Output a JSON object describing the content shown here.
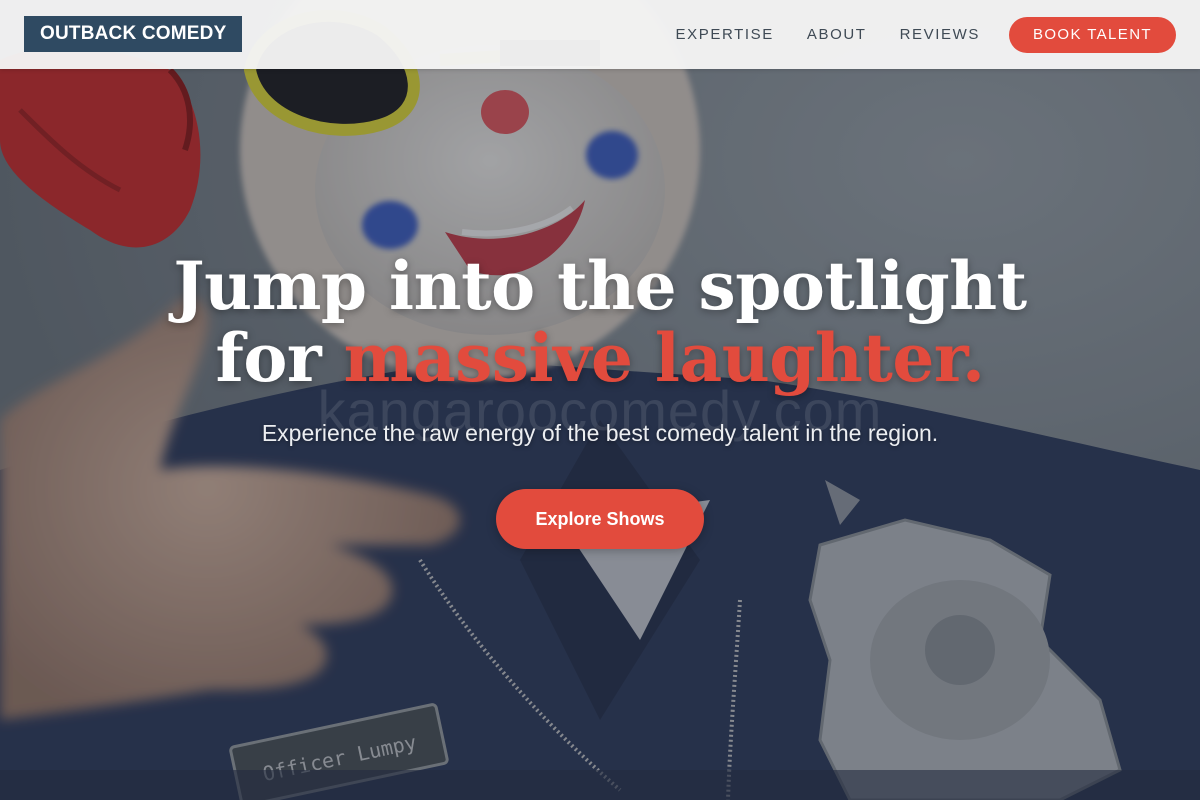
{
  "header": {
    "logo": "OUTBACK COMEDY",
    "nav": [
      {
        "label": "EXPERTISE"
      },
      {
        "label": "ABOUT"
      },
      {
        "label": "REVIEWS"
      }
    ],
    "book_button": "BOOK TALENT"
  },
  "hero": {
    "headline_line1": "Jump into the spotlight",
    "headline_line2_plain": "for ",
    "headline_line2_accent": "massive laughter.",
    "watermark": "kangaroocomedy.com",
    "subheading": "Experience the raw energy of the best comedy talent in the region.",
    "cta_label": "Explore Shows",
    "name_tag": "Officer Lumpy"
  },
  "colors": {
    "accent": "#e24b3d",
    "logo_bg": "#2f4a62",
    "header_bg": "#f5f5f5"
  }
}
